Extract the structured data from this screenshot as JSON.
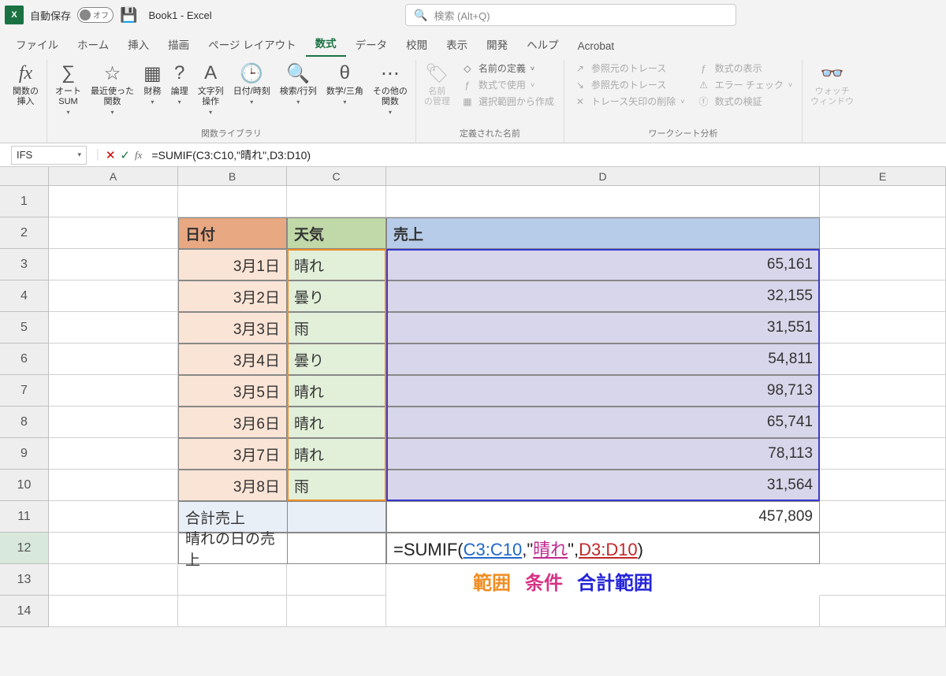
{
  "titlebar": {
    "autosave_label": "自動保存",
    "toggle_text": "オフ",
    "doc_title": "Book1  -  Excel",
    "search_placeholder": "検索 (Alt+Q)"
  },
  "tabs": [
    "ファイル",
    "ホーム",
    "挿入",
    "描画",
    "ページ レイアウト",
    "数式",
    "データ",
    "校閲",
    "表示",
    "開発",
    "ヘルプ",
    "Acrobat"
  ],
  "active_tab_index": 5,
  "ribbon": {
    "insert_fn": "関数の\n挿入",
    "autosum": "オート\nSUM",
    "recent": "最近使った\n関数",
    "finance": "財務",
    "logic": "論理",
    "text": "文字列\n操作",
    "datetime": "日付/時刻",
    "lookup": "検索/行列",
    "math": "数学/三角",
    "other": "その他の\n関数",
    "group_lib": "関数ライブラリ",
    "name_mgr": "名前\nの管理",
    "define_name": "名前の定義",
    "use_in_formula": "数式で使用",
    "create_from_sel": "選択範囲から作成",
    "group_names": "定義された名前",
    "trace_prec": "参照元のトレース",
    "trace_dep": "参照先のトレース",
    "remove_arrows": "トレース矢印の削除",
    "show_formulas": "数式の表示",
    "error_check": "エラー チェック",
    "eval_formula": "数式の検証",
    "group_audit": "ワークシート分析",
    "watch": "ウォッチ\nウィンドウ"
  },
  "formulabar": {
    "namebox": "IFS",
    "formula": "=SUMIF(C3:C10,\"晴れ\",D3:D10)"
  },
  "columns": [
    "A",
    "B",
    "C",
    "D",
    "E"
  ],
  "row_numbers": [
    "1",
    "2",
    "3",
    "4",
    "5",
    "6",
    "7",
    "8",
    "9",
    "10",
    "11",
    "12",
    "13",
    "14"
  ],
  "headers": {
    "date": "日付",
    "weather": "天気",
    "sales": "売上"
  },
  "data_rows": [
    {
      "date": "3月1日",
      "weather": "晴れ",
      "sales": "65,161"
    },
    {
      "date": "3月2日",
      "weather": "曇り",
      "sales": "32,155"
    },
    {
      "date": "3月3日",
      "weather": "雨",
      "sales": "31,551"
    },
    {
      "date": "3月4日",
      "weather": "曇り",
      "sales": "54,811"
    },
    {
      "date": "3月5日",
      "weather": "晴れ",
      "sales": "98,713"
    },
    {
      "date": "3月6日",
      "weather": "晴れ",
      "sales": "65,741"
    },
    {
      "date": "3月7日",
      "weather": "晴れ",
      "sales": "78,113"
    },
    {
      "date": "3月8日",
      "weather": "雨",
      "sales": "31,564"
    }
  ],
  "totals": {
    "total_label": "合計売上",
    "total_value": "457,809",
    "sunny_label": "晴れの日の売上"
  },
  "cell_formula": {
    "prefix": "=SUMIF(",
    "range1": "C3:C10",
    "sep1": ",\"",
    "cond": "晴れ",
    "sep2": "\",",
    "range2": "D3:D10",
    "suffix": ")"
  },
  "annotations": {
    "a1": "範囲",
    "a2": "条件",
    "a3": "合計範囲"
  }
}
